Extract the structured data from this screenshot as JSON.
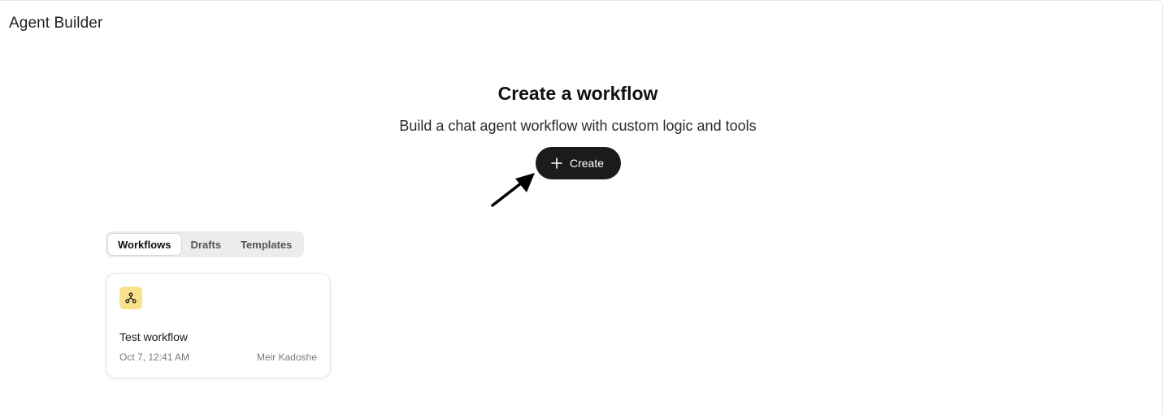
{
  "app": {
    "title": "Agent Builder"
  },
  "hero": {
    "title": "Create a workflow",
    "subtitle": "Build a chat agent workflow with custom logic and tools",
    "create_label": "Create"
  },
  "tabs": [
    {
      "label": "Workflows",
      "active": true
    },
    {
      "label": "Drafts",
      "active": false
    },
    {
      "label": "Templates",
      "active": false
    }
  ],
  "workflows": [
    {
      "name": "Test workflow",
      "date": "Oct 7, 12:41 AM",
      "author": "Meir Kadoshe",
      "icon": "workflow-icon",
      "icon_bg": "#fbe18d"
    }
  ],
  "colors": {
    "button_bg": "#1b1b1b",
    "tab_bg": "#ececec"
  }
}
